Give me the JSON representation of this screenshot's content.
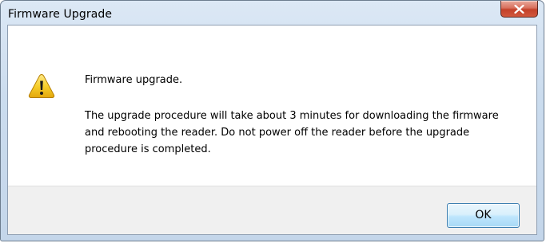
{
  "window": {
    "title": "Firmware Upgrade",
    "close_icon": "close-icon",
    "close_color": "#c3412a"
  },
  "message": {
    "icon": "warning-icon",
    "icon_color": "#f2c31a",
    "heading": "Firmware upgrade.",
    "body": "The upgrade procedure will take about 3 minutes for downloading the firmware and rebooting the reader. Do not power off the reader before the upgrade procedure is completed."
  },
  "buttons": {
    "ok_label": "OK"
  }
}
